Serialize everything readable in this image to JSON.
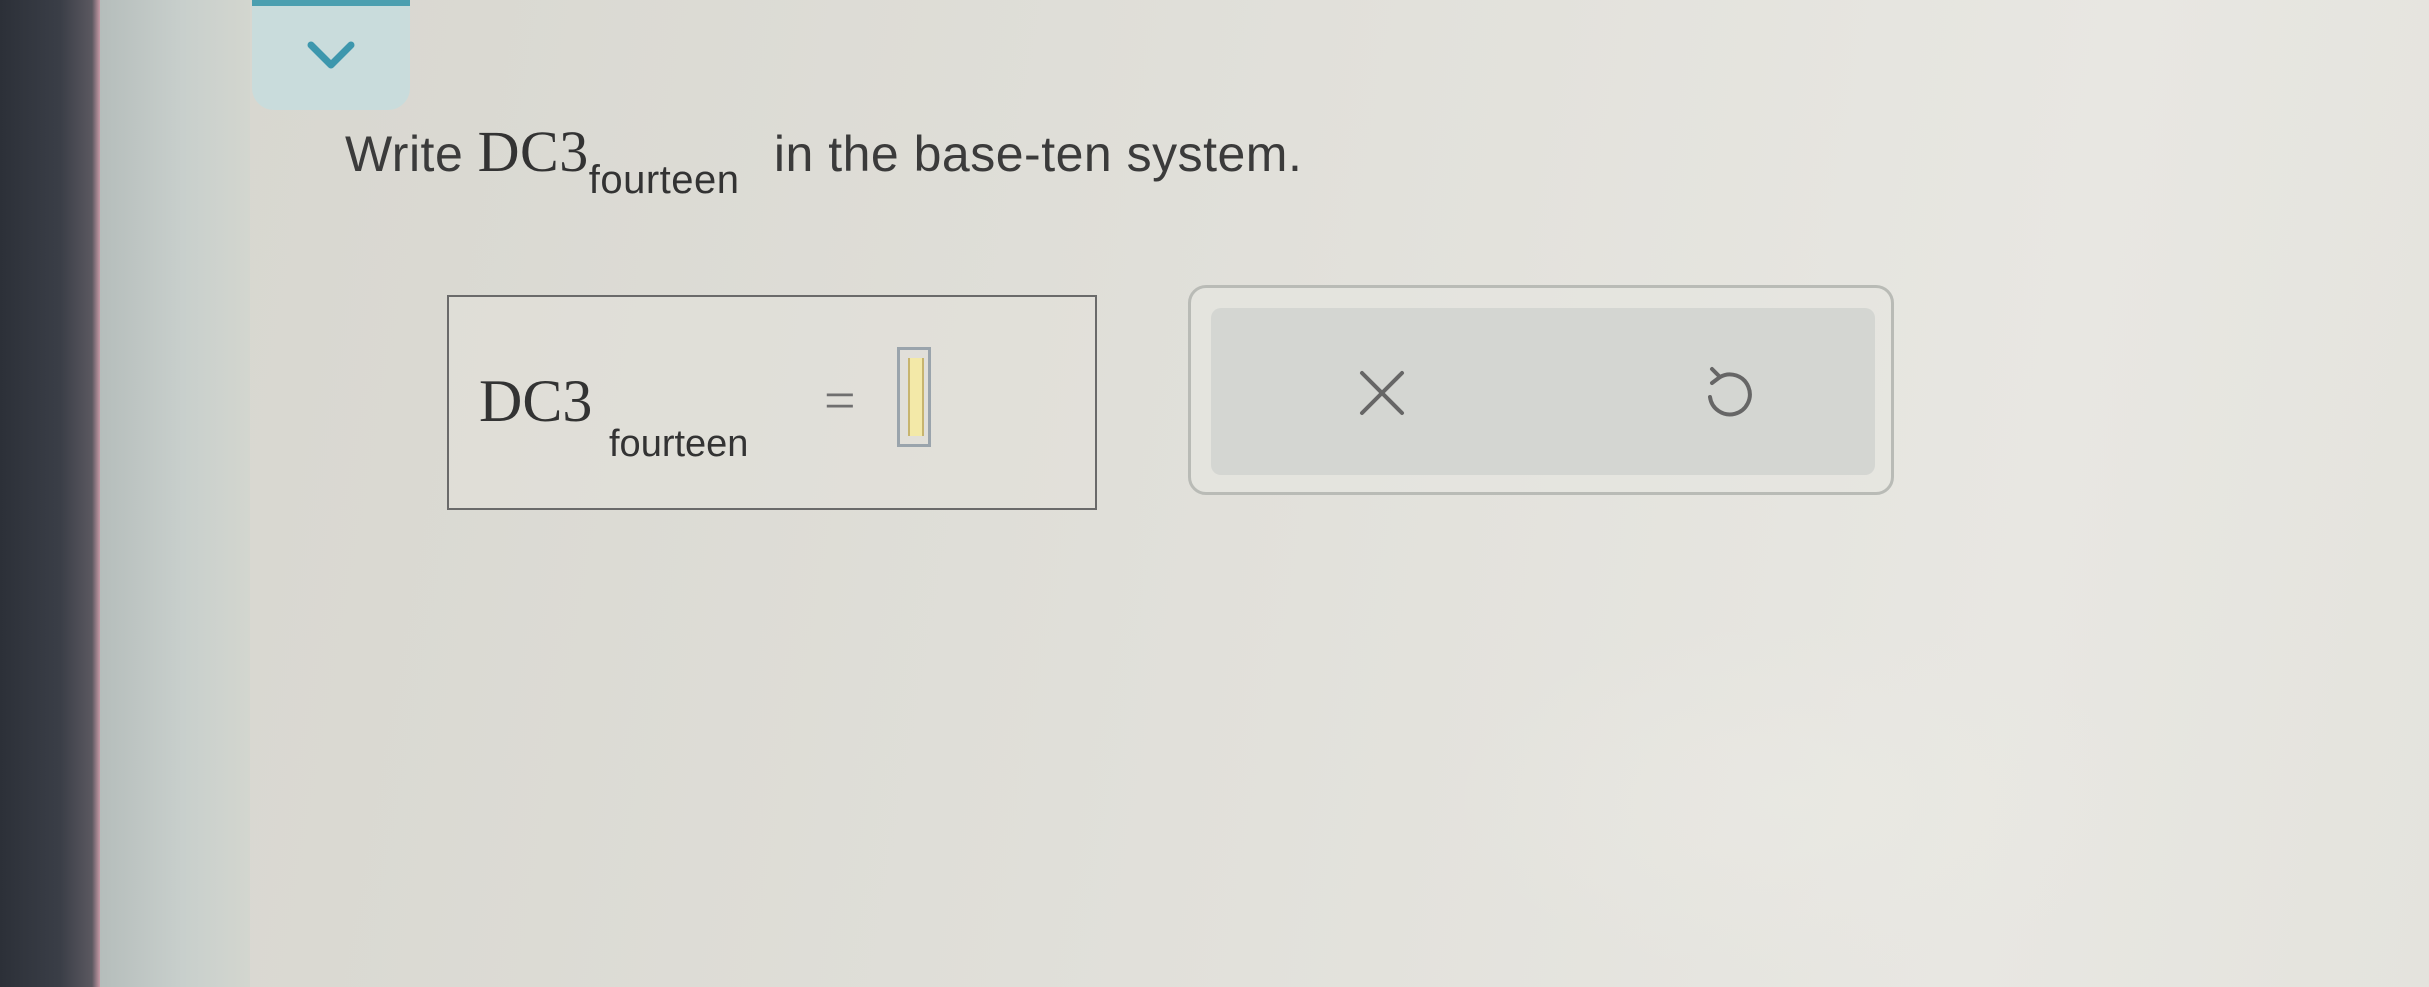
{
  "question": {
    "prefix": "Write",
    "number": "DC3",
    "base": "fourteen",
    "suffix": "in the base-ten system."
  },
  "answer": {
    "number": "DC3",
    "base": "fourteen",
    "equals": "=",
    "value": ""
  },
  "tools": {
    "clear_icon": "x-icon",
    "undo_icon": "undo-icon"
  },
  "colors": {
    "accent": "#4b9fb0",
    "collapse_tab_bg": "#c9dcdc",
    "text": "#3b3b3b"
  }
}
